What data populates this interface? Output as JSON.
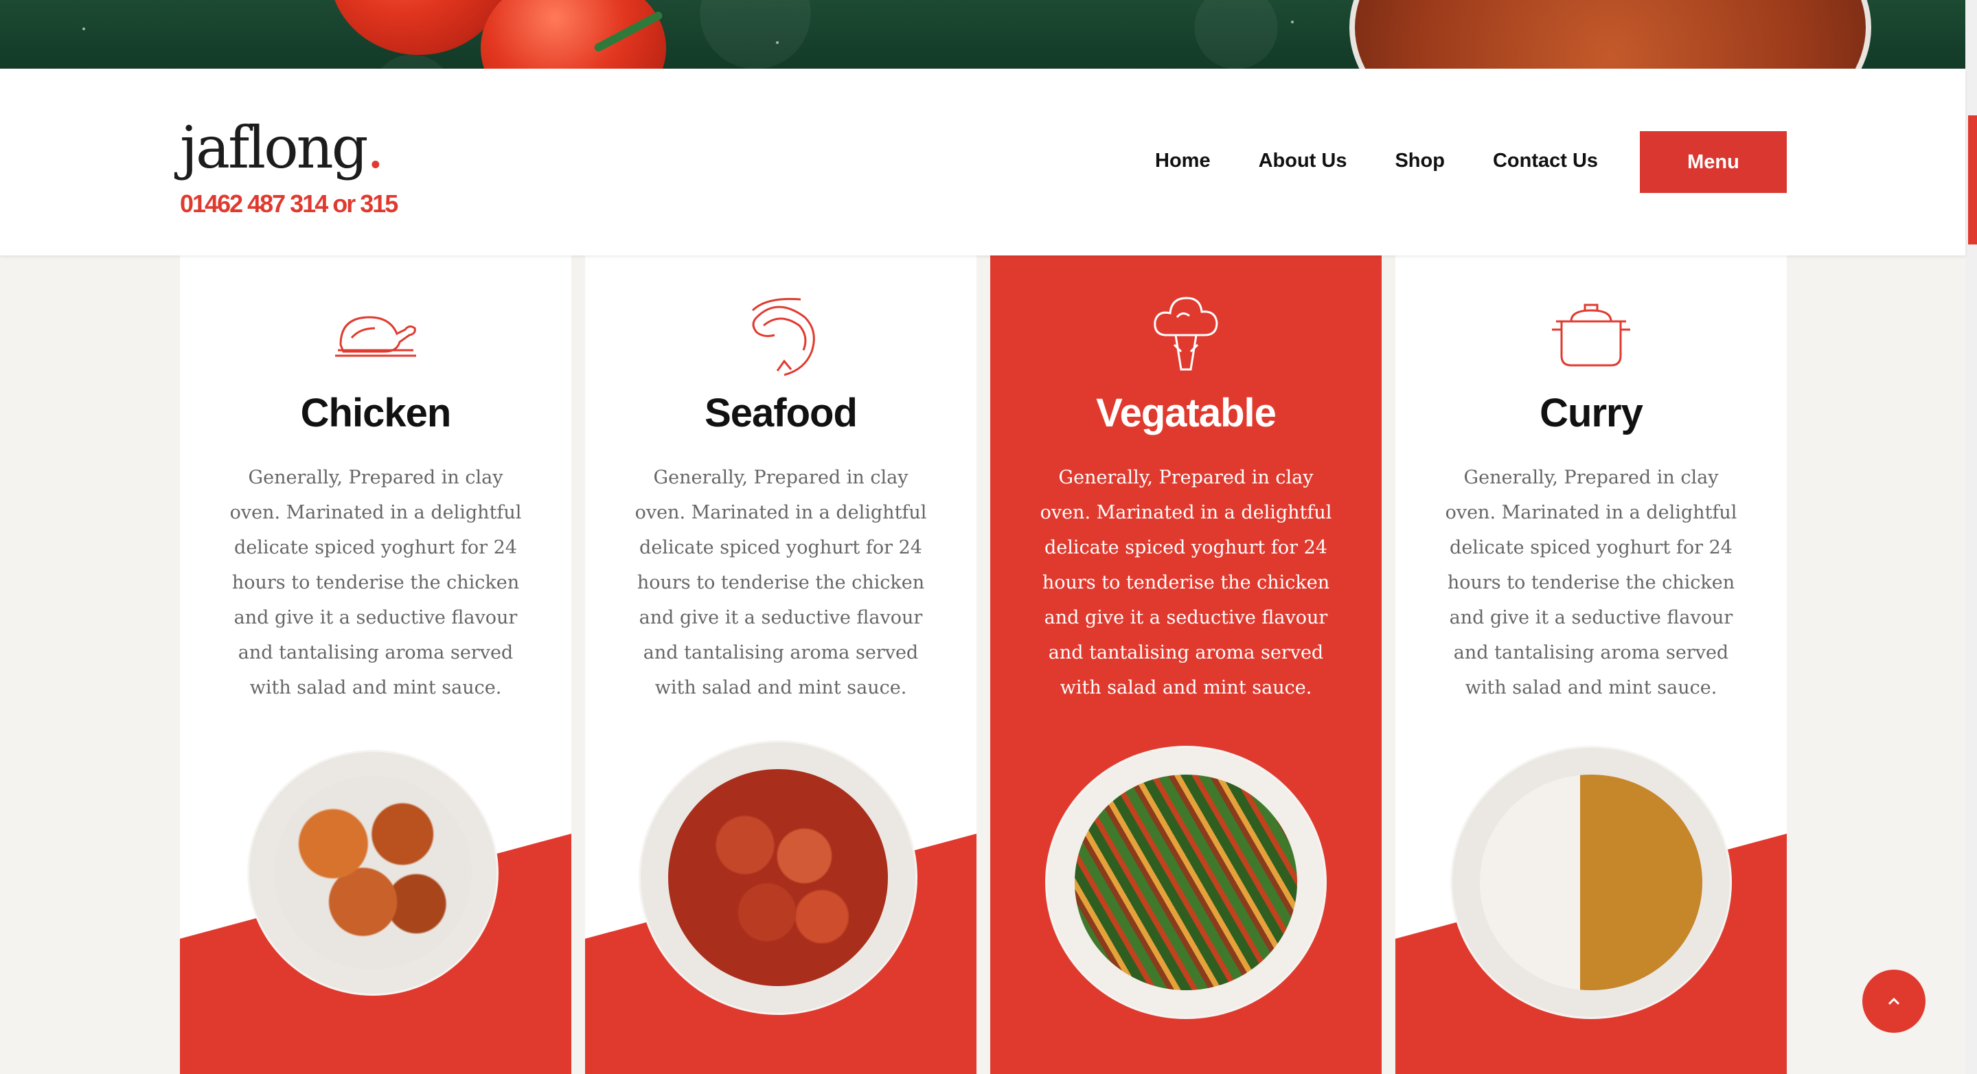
{
  "header": {
    "logo_text": "jaflong",
    "logo_dot": ".",
    "phone": "01462 487 314 or 315",
    "nav": [
      "Home",
      "About Us",
      "Shop",
      "Contact Us"
    ],
    "menu_button": "Menu"
  },
  "cards": [
    {
      "title": "Chicken",
      "icon": "roast-chicken-icon",
      "description": "Generally, Prepared in clay oven. Marinated in a delightful delicate spiced yoghurt for 24 hours to tenderise the chicken and give it a seductive flavour and tantalising aroma served with salad and mint sauce."
    },
    {
      "title": "Seafood",
      "icon": "shrimp-icon",
      "description": "Generally, Prepared in clay oven. Marinated in a delightful delicate spiced yoghurt for 24 hours to tenderise the chicken and give it a seductive flavour and tantalising aroma served with salad and mint sauce."
    },
    {
      "title": "Vegatable",
      "icon": "broccoli-icon",
      "description": "Generally, Prepared in clay oven. Marinated in a delightful delicate spiced yoghurt for 24 hours to tenderise the chicken and give it a seductive flavour and tantalising aroma served with salad and mint sauce."
    },
    {
      "title": "Curry",
      "icon": "cooking-pot-icon",
      "description": "Generally, Prepared in clay oven. Marinated in a delightful delicate spiced yoghurt for 24 hours to tenderise the chicken and give it a seductive flavour and tantalising aroma served with salad and mint sauce."
    }
  ],
  "active_card": "Vegatable",
  "colors": {
    "accent": "#e03a2f",
    "text_dark": "#111111",
    "text_muted": "#666666"
  }
}
